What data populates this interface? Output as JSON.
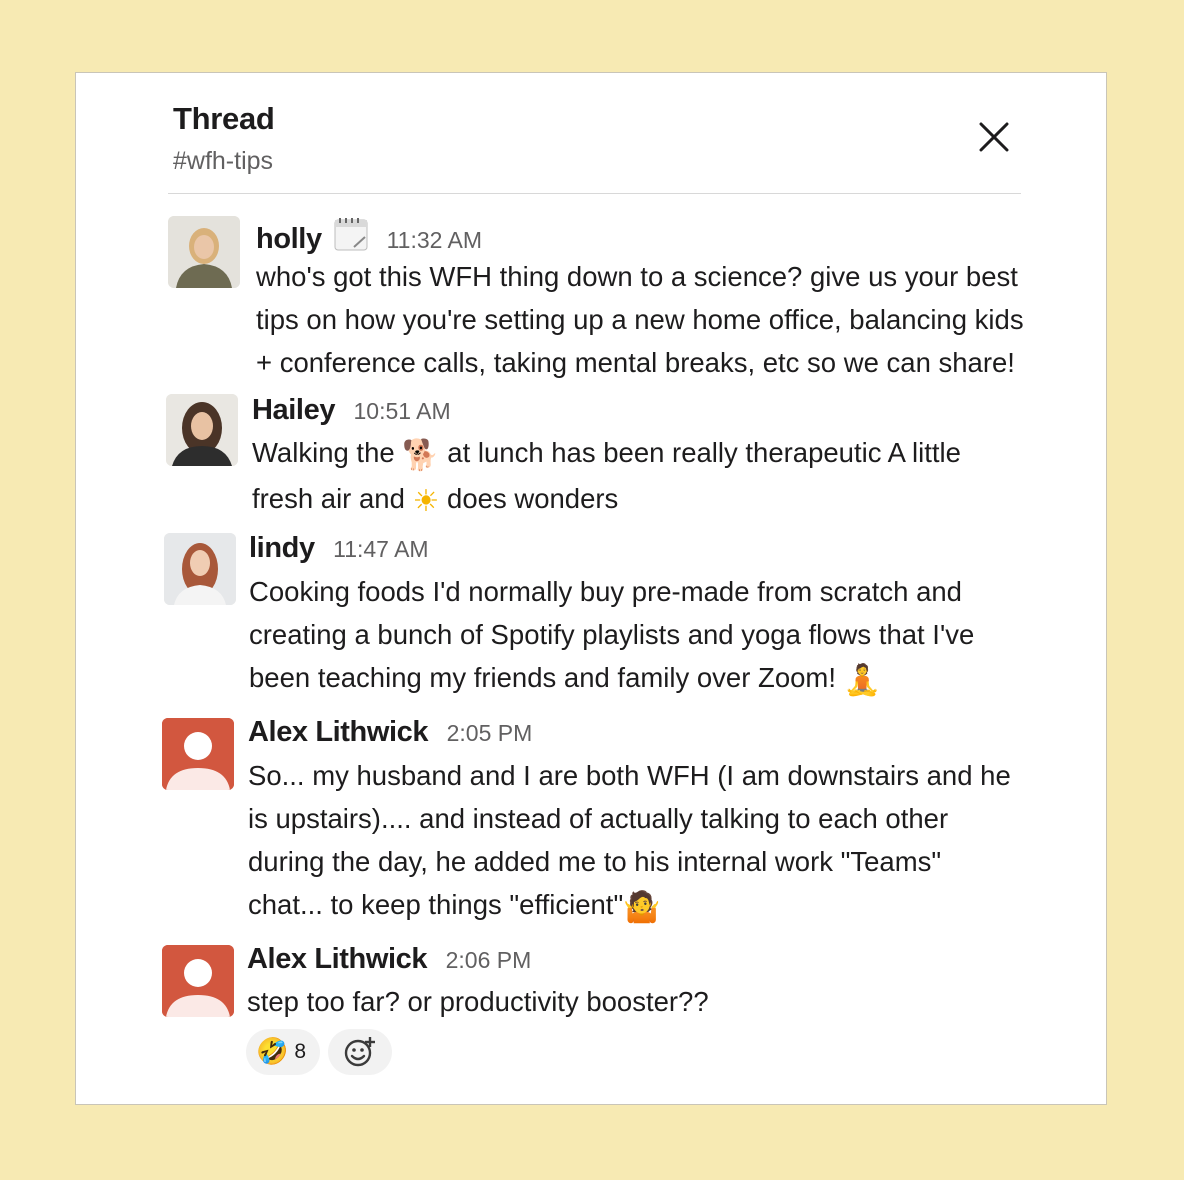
{
  "thread": {
    "title": "Thread",
    "channel": "#wfh-tips"
  },
  "messages": [
    {
      "author": "holly",
      "status_icon": "calendar-icon",
      "time": "11:32 AM",
      "lines": [
        "who's got this WFH thing down to a science? give us your best",
        "tips on how you're setting up a new home office, balancing kids",
        "+ conference calls, taking mental breaks, etc so we can share!"
      ]
    },
    {
      "author": "Hailey",
      "time": "10:51 AM",
      "lines": [
        {
          "a": "Walking the ",
          "emoji": "🐕",
          "b": " at lunch has been really therapeutic A little"
        },
        {
          "a": "fresh air and ",
          "emoji": "☀",
          "b": " does wonders"
        }
      ]
    },
    {
      "author": "lindy",
      "time": "11:47 AM",
      "lines": [
        "Cooking foods I'd normally buy pre-made from scratch and",
        "creating a bunch of Spotify playlists and yoga flows that I've",
        {
          "a": "been teaching my friends and family over Zoom! ",
          "emoji": "🧘"
        }
      ]
    },
    {
      "author": "Alex Lithwick",
      "time": "2:05 PM",
      "lines": [
        "So... my husband and I are both WFH (I am downstairs and he",
        "is upstairs).... and instead of actually talking to each other",
        "during the day, he added me to his internal work \"Teams\"",
        {
          "a": "chat... to keep things \"efficient\"",
          "emoji": "🤷"
        }
      ]
    },
    {
      "author": "Alex Lithwick",
      "time": "2:06 PM",
      "lines": [
        "step too far? or productivity booster??"
      ]
    }
  ],
  "reactions": [
    {
      "emoji": "🤣",
      "count": "8"
    }
  ],
  "add_reaction_icon": "add-reaction-icon",
  "colors": {
    "background": "#f7eab3",
    "avatar_generic": "#d2573f",
    "muted_text": "#616061"
  }
}
